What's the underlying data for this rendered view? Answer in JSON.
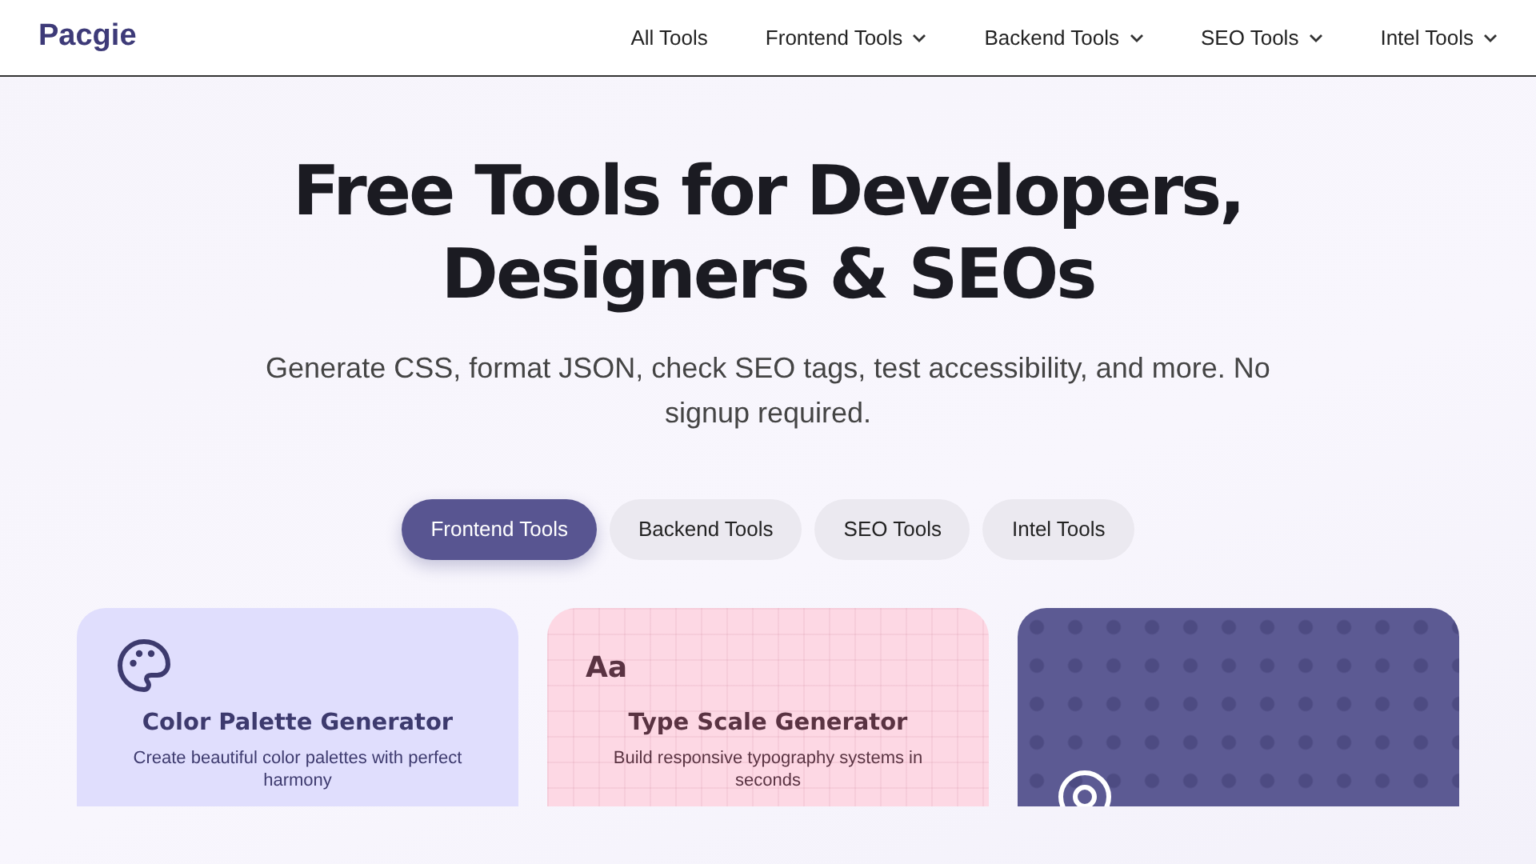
{
  "brand": "Pacgie",
  "nav": [
    {
      "label": "All Tools",
      "dropdown": false
    },
    {
      "label": "Frontend Tools",
      "dropdown": true
    },
    {
      "label": "Backend Tools",
      "dropdown": true
    },
    {
      "label": "SEO Tools",
      "dropdown": true
    },
    {
      "label": "Intel Tools",
      "dropdown": true
    }
  ],
  "hero": {
    "title": "Free Tools for Developers, Designers & SEOs",
    "subtitle": "Generate CSS, format JSON, check SEO tags, test accessibility, and more. No signup required."
  },
  "tabs": [
    {
      "label": "Frontend Tools",
      "selected": true
    },
    {
      "label": "Backend Tools",
      "selected": false
    },
    {
      "label": "SEO Tools",
      "selected": false
    },
    {
      "label": "Intel Tools",
      "selected": false
    }
  ],
  "cards": [
    {
      "kind": "palette",
      "title": "Color Palette Generator",
      "description": "Create beautiful color palettes with perfect harmony"
    },
    {
      "kind": "type",
      "icon_text": "Aa",
      "title": "Type Scale Generator",
      "description": "Build responsive typography systems in seconds"
    },
    {
      "kind": "pattern"
    }
  ]
}
